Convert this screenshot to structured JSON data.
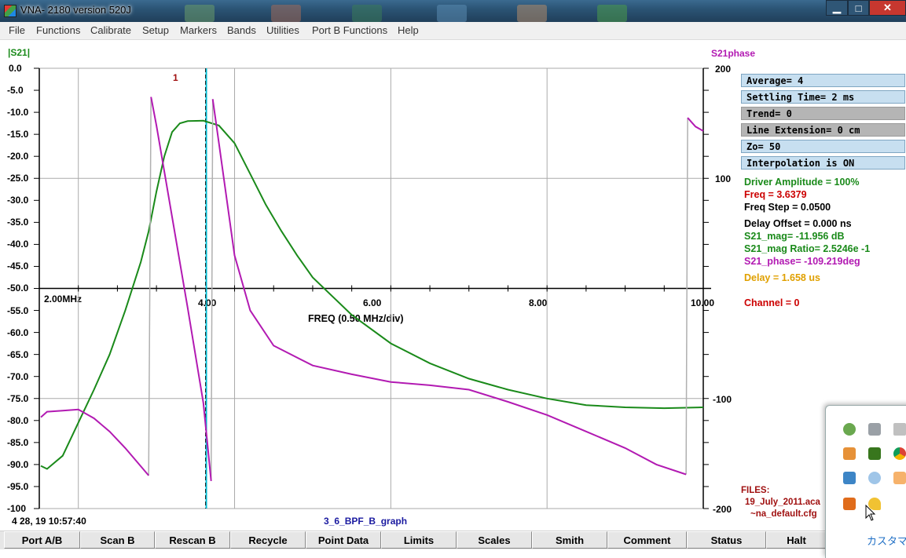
{
  "window": {
    "title": "VNA- 2180    version 520J",
    "controls": [
      "▁",
      "□",
      "✕"
    ]
  },
  "menu": [
    "File",
    "Functions",
    "Calibrate",
    "Setup",
    "Markers",
    "Bands",
    "Utilities",
    "Port B Functions",
    "Help"
  ],
  "graph": {
    "left_axis_title": "|S21|",
    "right_axis_title": "S21phase",
    "left_ticks": [
      "0.0",
      "-5.0",
      "-10.0",
      "-15.0",
      "-20.0",
      "-25.0",
      "-30.0",
      "-35.0",
      "-40.0",
      "-45.0",
      "-50.0",
      "-55.0",
      "-60.0",
      "-65.0",
      "-70.0",
      "-75.0",
      "-80.0",
      "-85.0",
      "-90.0",
      "-95.0",
      "-100"
    ],
    "right_ticks": [
      "200",
      "100",
      "-100",
      "-200"
    ],
    "freq_ticks": [
      "2.00MHz",
      "4.00",
      "6.00",
      "8.00",
      "10.00"
    ],
    "freq_label": "FREQ (0.50 MHz/div)",
    "marker_label": "1",
    "timestamp": "4 28, 19  10:57:40",
    "graph_name": "3_6_BPF_B_graph"
  },
  "settings_boxes": [
    {
      "text": "Average= 4",
      "style": "blue"
    },
    {
      "text": "Settling Time= 2 ms",
      "style": "blue"
    },
    {
      "text": "Trend= 0",
      "style": "gray"
    },
    {
      "text": "Line Extension= 0 cm",
      "style": "gray"
    },
    {
      "text": "Zo= 50",
      "style": "blue"
    },
    {
      "text": "Interpolation is ON",
      "style": "blue"
    }
  ],
  "readouts": {
    "driver_amplitude": "Driver Amplitude = 100%",
    "freq": "Freq =  3.6379",
    "freq_step": "Freq Step =  0.0500",
    "delay_offset": "Delay Offset =  0.000 ns",
    "s21_mag": "S21_mag= -11.956 dB",
    "s21_mag_ratio": "S21_mag Ratio= 2.5246e -1",
    "s21_phase": "S21_phase= -109.219deg",
    "delay": "Delay =  1.658 us",
    "channel": "Channel = 0"
  },
  "files": {
    "label": "FILES:",
    "file1": "19_July_2011.aca",
    "file2": "~na_default.cfg"
  },
  "buttons": [
    "Port A/B",
    "Scan B",
    "Rescan B",
    "Recycle",
    "Point Data",
    "Limits",
    "Scales",
    "Smith",
    "Comment",
    "Status",
    "Halt"
  ],
  "tray": {
    "link": "カスタマ",
    "icons": [
      "network-icon",
      "monitor-icon",
      "volume-icon",
      "usb-icon",
      "sync-icon",
      "chrome-icon",
      "puzzle-icon",
      "disc-icon",
      "keys-icon",
      "app-icon",
      "key-icon"
    ]
  },
  "colors": {
    "magnitude_trace": "#1a8a1a",
    "phase_trace": "#b21ab2",
    "marker_line": "#00bcd4",
    "grid": "#aaaaaa",
    "freq_red": "#cc0000",
    "delay_orange": "#e0a000",
    "name_blue": "#1a1aa0"
  },
  "chart_data": {
    "type": "line",
    "title": "",
    "xlabel": "FREQ (0.50 MHz/div)",
    "ylabel": "|S21|",
    "y2label": "S21phase",
    "xlim": [
      1.5,
      10.0
    ],
    "ylim": [
      -100,
      0
    ],
    "y2lim": [
      -200,
      200
    ],
    "x_ticks": [
      2,
      4,
      6,
      8,
      10
    ],
    "marker_x": 3.6379,
    "series": [
      {
        "name": "|S21|",
        "axis": "left",
        "x": [
          1.52,
          1.6,
          1.8,
          2.0,
          2.2,
          2.4,
          2.6,
          2.8,
          2.9,
          3.0,
          3.1,
          3.2,
          3.3,
          3.4,
          3.6,
          3.8,
          4.0,
          4.2,
          4.4,
          4.6,
          4.8,
          5.0,
          5.5,
          6.0,
          6.5,
          7.0,
          7.5,
          8.0,
          8.5,
          9.0,
          9.5,
          10.0
        ],
        "y": [
          -90.3,
          -91,
          -88,
          -80.5,
          -73,
          -65,
          -55,
          -44,
          -37,
          -28,
          -20,
          -14.5,
          -12.5,
          -12,
          -11.9,
          -13,
          -17,
          -24,
          -31,
          -37,
          -42.5,
          -47.5,
          -56,
          -62.5,
          -67,
          -70.5,
          -73,
          -75,
          -76.5,
          -77,
          -77.2,
          -77
        ]
      },
      {
        "name": "S21phase",
        "axis": "right",
        "x": [
          1.52,
          1.6,
          1.8,
          2.0,
          2.2,
          2.4,
          2.6,
          2.9,
          2.93,
          3.0,
          3.2,
          3.4,
          3.6,
          3.7,
          3.72,
          3.8,
          4.0,
          4.2,
          4.5,
          5.0,
          5.5,
          6.0,
          6.5,
          7.0,
          7.5,
          8.0,
          8.5,
          9.0,
          9.4,
          9.78,
          9.8,
          9.9,
          10.0
        ],
        "y": [
          -117,
          -112,
          -111,
          -110,
          -118,
          -130,
          -145,
          -170,
          174,
          148,
          65,
          -18,
          -104,
          -175,
          172,
          132,
          30,
          -20,
          -52,
          -70,
          -78,
          -85,
          -88,
          -92,
          -103,
          -115,
          -130,
          -145,
          -160,
          -169,
          155,
          147,
          143
        ]
      }
    ]
  }
}
